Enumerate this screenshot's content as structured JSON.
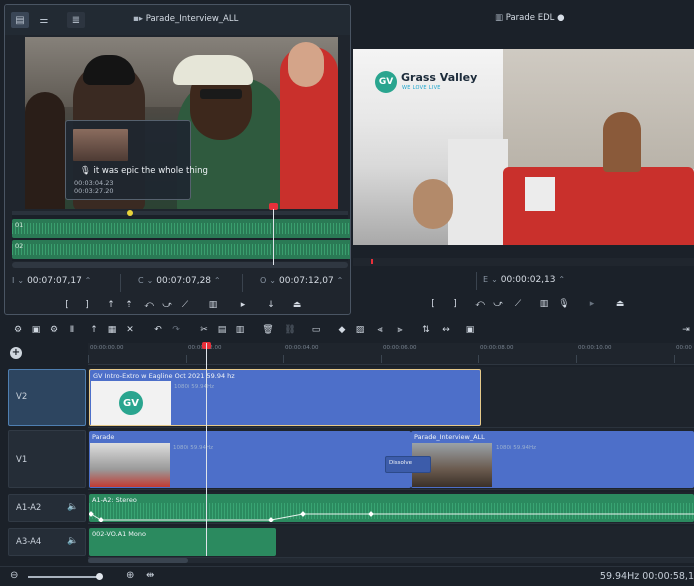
{
  "source": {
    "title": "Parade_Interview_ALL",
    "tooltip_text": "it was epic the whole thing",
    "tooltip_tc1": "00:03:04.23",
    "tooltip_tc2": "00:03:27.20",
    "tracks": [
      "01",
      "02"
    ],
    "in_label": "I",
    "in_tc": "00:07:07,17",
    "current_label": "C",
    "current_tc": "00:07:07,28",
    "out_label": "O",
    "out_tc": "00:07:12,07"
  },
  "program": {
    "title": "Parade EDL",
    "logo_mark": "GV",
    "logo_brand": "Grass Valley",
    "logo_tagline": "WE LOVE LIVE",
    "end_label": "E",
    "end_tc": "00:00:02,13"
  },
  "timeline": {
    "ruler_labels": [
      "00:00:00.00",
      "00:00:02.00",
      "00:00:04.00",
      "00:00:06.00",
      "00:00:08.00",
      "00:00:10.00",
      "00:00"
    ],
    "tracks": {
      "v2": "V2",
      "v1": "V1",
      "a1a2": "A1-A2",
      "a3a4": "A3-A4"
    },
    "clips": {
      "v2_title": "GV Intro-Extro w Eagline Oct 2021 59.94 hz",
      "v2_format": "1080i 59.94Hz",
      "v1a_title": "Parade",
      "v1a_format": "1080i 59.94Hz",
      "v1b_title": "Parade_Interview_ALL",
      "v1b_format": "1080i 59.94Hz",
      "transition": "Dissolve",
      "a1_title": "A1-A2: Stereo",
      "a3_title": "002-VO.A1 Mono"
    }
  },
  "status": {
    "rate": "59.94Hz",
    "duration": "00:00:58,1"
  },
  "colors": {
    "accent_clip": "#4e7ad0",
    "audio": "#2b8a5f",
    "playhead": "#e8303a"
  }
}
